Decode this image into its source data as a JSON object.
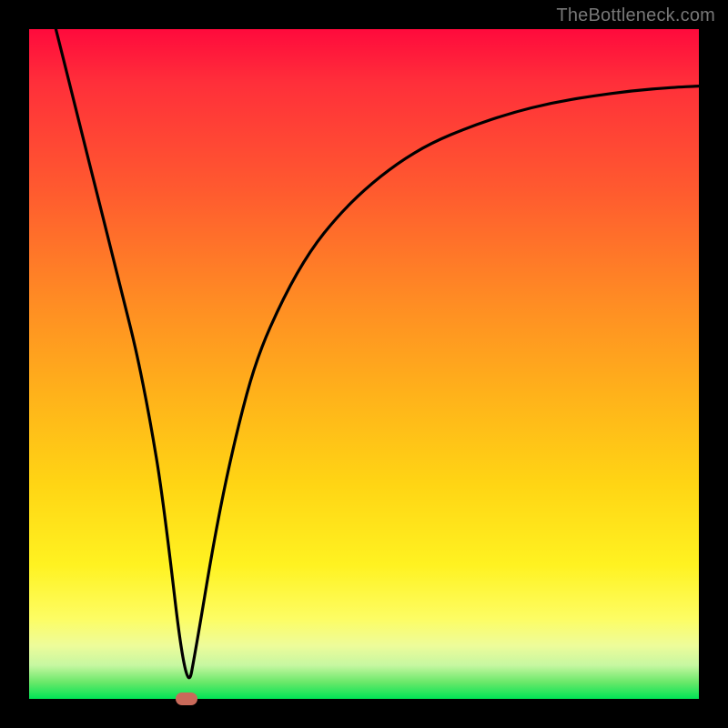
{
  "watermark": "TheBottleneck.com",
  "chart_data": {
    "type": "line",
    "title": "",
    "xlabel": "",
    "ylabel": "",
    "xlim": [
      0,
      100
    ],
    "ylim": [
      0,
      100
    ],
    "grid": false,
    "legend": false,
    "series": [
      {
        "name": "curve",
        "x": [
          4,
          6,
          8,
          10,
          12,
          14,
          16,
          18,
          20,
          23.5,
          25,
          28,
          31,
          34,
          38,
          42,
          46,
          50,
          55,
          60,
          66,
          72,
          78,
          84,
          90,
          96,
          100
        ],
        "values": [
          100,
          92,
          84,
          76,
          68,
          60,
          52,
          42,
          30,
          0,
          8,
          26,
          40,
          51,
          60,
          67,
          72,
          76,
          80,
          83,
          85.5,
          87.5,
          89,
          90,
          90.8,
          91.3,
          91.5
        ]
      }
    ],
    "marker": {
      "x": 23.5,
      "y": 0
    },
    "background_gradient": {
      "top": "#ff0a3c",
      "mid": "#ffd514",
      "bottom": "#00e455"
    }
  }
}
